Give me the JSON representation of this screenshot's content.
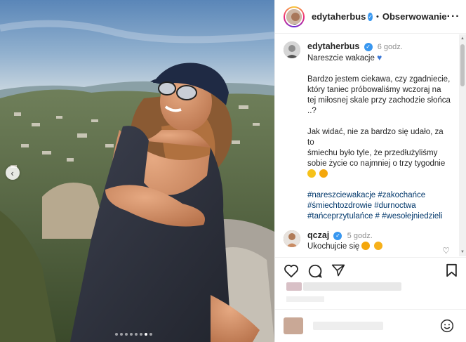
{
  "post": {
    "username": "edytaherbus",
    "separator": "•",
    "follow_label": "Obserwowanie",
    "more_label": "···",
    "caption_time": "6 godz.",
    "caption_line1": "Nareszcie wakacje",
    "caption_p2_1": "Bardzo jestem ciekawa, czy zgadniecie,",
    "caption_p2_2": "który taniec próbowaliśmy wczoraj na",
    "caption_p2_3": "tej miłosnej skale przy zachodzie słońca",
    "caption_p2_4": "..?",
    "caption_p3_1": "Jak widać, nie za bardzo się udało, za to",
    "caption_p3_2": "śmiechu było tyle, że przedłużyliśmy",
    "caption_p3_3": "sobie życie co najmniej o trzy tygodnie",
    "hashtags_1": "#nareszciewakacje #zakochańce",
    "hashtags_2": "#śmiechtozdrowie #durnoctwa",
    "hashtags_3": "#tańceprzytulańce # #wesołejniedzieli"
  },
  "reply": {
    "username": "qczaj",
    "time": "5 godz.",
    "text": "Ukochujcie się"
  },
  "icons": [
    "heart-icon",
    "comment-icon",
    "share-icon",
    "bookmark-icon",
    "emoji-icon",
    "verified-icon",
    "chevron-left-icon"
  ],
  "carousel": {
    "count": 8,
    "active": 7
  },
  "colors": {
    "verified": "#3897f0",
    "hashtag": "#00376b",
    "text": "#262626",
    "muted": "#8e8e8e"
  }
}
